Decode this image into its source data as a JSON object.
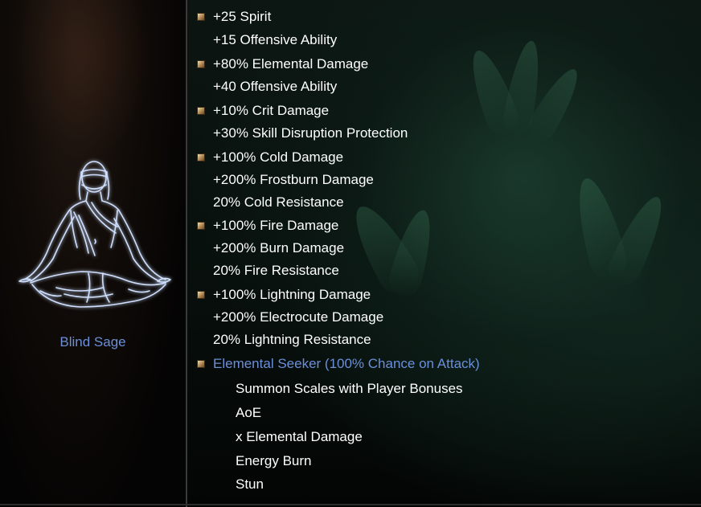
{
  "constellation": {
    "name": "Blind Sage",
    "figure_icon": "meditating-sage-icon",
    "accent_color": "#6b8fd8"
  },
  "bonuses": [
    {
      "text": "+25 Spirit",
      "bullet": true
    },
    {
      "text": "+15 Offensive Ability",
      "bullet": false
    },
    {
      "text": "+80% Elemental Damage",
      "bullet": true
    },
    {
      "text": "+40 Offensive Ability",
      "bullet": false
    },
    {
      "text": "+10% Crit Damage",
      "bullet": true
    },
    {
      "text": "+30% Skill Disruption Protection",
      "bullet": false
    },
    {
      "text": "+100% Cold Damage",
      "bullet": true
    },
    {
      "text": "+200% Frostburn Damage",
      "bullet": false
    },
    {
      "text": "20% Cold Resistance",
      "bullet": false
    },
    {
      "text": "+100% Fire Damage",
      "bullet": true
    },
    {
      "text": "+200% Burn Damage",
      "bullet": false
    },
    {
      "text": "20% Fire Resistance",
      "bullet": false
    },
    {
      "text": "+100% Lightning Damage",
      "bullet": true
    },
    {
      "text": "+200% Electrocute Damage",
      "bullet": false
    },
    {
      "text": "20% Lightning Resistance",
      "bullet": false
    }
  ],
  "skill": {
    "title": "Elemental Seeker (100% Chance on Attack)",
    "details": [
      "Summon Scales with Player Bonuses",
      "AoE",
      "x Elemental Damage",
      "Energy Burn",
      "Stun"
    ]
  }
}
